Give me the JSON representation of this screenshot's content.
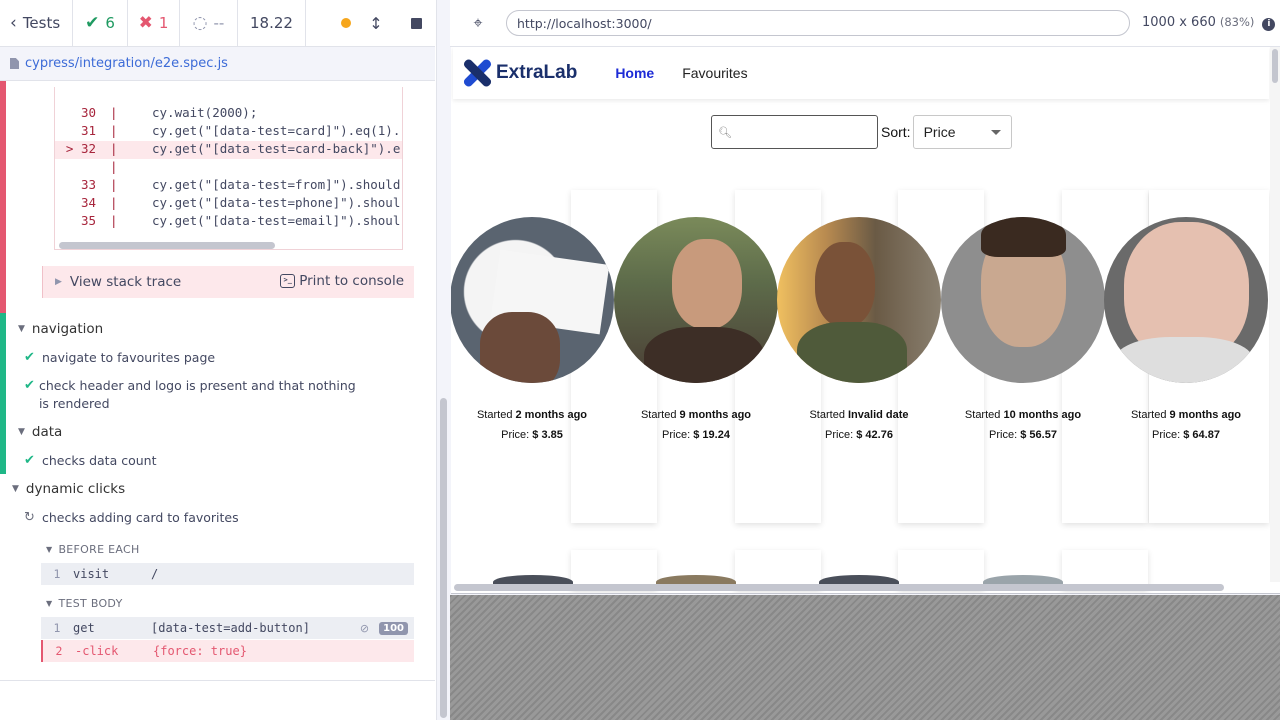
{
  "reporter": {
    "tests_label": "Tests",
    "passed": "6",
    "failed": "1",
    "pending": "--",
    "duration": "18.22",
    "spec_path": "cypress/integration/e2e.spec.js"
  },
  "code_frame": [
    {
      "num": "30",
      "code": "cy.wait(2000);"
    },
    {
      "num": "31",
      "code": "cy.get(\"[data-test=card]\").eq(1)."
    },
    {
      "num": "> 32",
      "code": "cy.get(\"[data-test=card-back]\").e"
    },
    {
      "num": "",
      "code": ""
    },
    {
      "num": "33",
      "code": "cy.get(\"[data-test=from]\").should"
    },
    {
      "num": "34",
      "code": "cy.get(\"[data-test=phone]\").shoul"
    },
    {
      "num": "35",
      "code": "cy.get(\"[data-test=email]\").shoul"
    }
  ],
  "stack": {
    "view_label": "View stack trace",
    "print_label": "Print to console"
  },
  "suites": {
    "navigation": {
      "title": "navigation",
      "tests": [
        "navigate to favourites page",
        "check header and logo is present and that nothing is rendered"
      ]
    },
    "data": {
      "title": "data",
      "tests": [
        "checks data count"
      ]
    },
    "dynamic": {
      "title": "dynamic clicks",
      "test": "checks adding card to favorites",
      "before_each": "BEFORE EACH",
      "test_body": "TEST BODY",
      "commands": [
        {
          "num": "1",
          "name": "visit",
          "arg": "/"
        },
        {
          "num": "1",
          "name": "get",
          "arg": "[data-test=add-button]",
          "count": "100"
        },
        {
          "num": "2",
          "name": "-click",
          "arg": "{force: true}"
        }
      ]
    }
  },
  "runner": {
    "url": "http://localhost:3000/",
    "viewport": "1000 x 660",
    "scale": "(83%)"
  },
  "app": {
    "logo_text": "ExtraLab",
    "nav": [
      "Home",
      "Favourites"
    ],
    "sort_label": "Sort:",
    "sort_value": "Price",
    "cards": [
      {
        "started_prefix": "Started",
        "started": "2 months ago",
        "price_prefix": "Price:",
        "price": "$ 3.85"
      },
      {
        "started_prefix": "Started",
        "started": "9 months ago",
        "price_prefix": "Price:",
        "price": "$ 19.24"
      },
      {
        "started_prefix": "Started",
        "started": "Invalid date",
        "price_prefix": "Price:",
        "price": "$ 42.76"
      },
      {
        "started_prefix": "Started",
        "started": "10 months ago",
        "price_prefix": "Price:",
        "price": "$ 56.57"
      },
      {
        "started_prefix": "Started",
        "started": "9 months ago",
        "price_prefix": "Price:",
        "price": "$ 64.87"
      }
    ]
  },
  "colors": {
    "pass": "#1fb787",
    "fail": "#e45770",
    "link": "#3c6bd7",
    "brand": "#1a2f6b",
    "nav_active": "#1d2bd6"
  }
}
